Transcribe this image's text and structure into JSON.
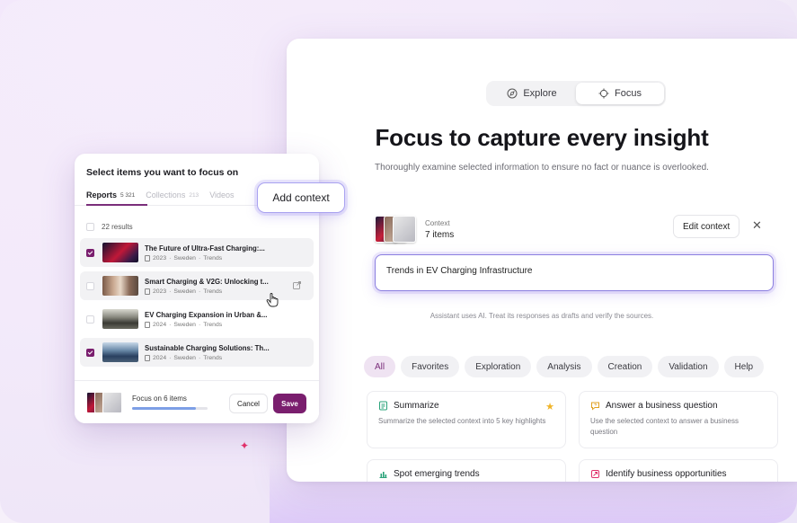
{
  "colors": {
    "accent_plum": "#7a1e6e",
    "focus_border": "#8b7fe0",
    "star": "#f0b428",
    "sparkle": "#e0306a",
    "progress_fill": "#7d9fe6"
  },
  "mode_switch": {
    "explore_label": "Explore",
    "explore_icon": "compass-icon",
    "focus_label": "Focus",
    "focus_icon": "crosshair-icon",
    "active": "Focus"
  },
  "hero": {
    "title": "Focus to capture every insight",
    "subtitle": "Thoroughly examine selected information to ensure no fact or nuance is overlooked."
  },
  "context": {
    "label": "Context",
    "count": "7 items",
    "edit_label": "Edit context",
    "close_icon": "close-icon"
  },
  "query": {
    "value": "Trends in EV Charging Infrastructure"
  },
  "disclaimer": "Assistant uses AI. Treat its responses as drafts and verify the sources.",
  "filters": [
    "All",
    "Favorites",
    "Exploration",
    "Analysis",
    "Creation",
    "Validation",
    "Help"
  ],
  "filters_active": "All",
  "cards": [
    {
      "title": "Summarize",
      "icon": "summarize-icon",
      "desc": "Summarize the selected context into 5 key highlights",
      "favorite": true
    },
    {
      "title": "Answer a business question",
      "icon": "chat-question-icon",
      "desc": "Use the selected context to answer a business question",
      "favorite": false
    },
    {
      "title": "Spot emerging trends",
      "icon": "bar-chart-icon",
      "desc": "",
      "favorite": false
    },
    {
      "title": "Identify business opportunities",
      "icon": "target-icon",
      "desc": "",
      "favorite": false
    }
  ],
  "selector": {
    "title": "Select items you want to focus on",
    "tabs": [
      {
        "label": "Reports",
        "count": "5 321",
        "active": true
      },
      {
        "label": "Collections",
        "count": "213",
        "active": false
      },
      {
        "label": "Videos",
        "count": "",
        "active": false
      }
    ],
    "results": "22 results",
    "items": [
      {
        "title": "The Future of Ultra-Fast Charging:...",
        "year": "2023",
        "country": "Sweden",
        "type": "Trends",
        "checked": true,
        "highlighted": true
      },
      {
        "title": "Smart Charging & V2G: Unlocking t...",
        "year": "2023",
        "country": "Sweden",
        "type": "Trends",
        "checked": false,
        "highlighted": true
      },
      {
        "title": "EV Charging Expansion in Urban &...",
        "year": "2024",
        "country": "Sweden",
        "type": "Trends",
        "checked": false,
        "highlighted": false
      },
      {
        "title": "Sustainable Charging Solutions: Th...",
        "year": "2024",
        "country": "Sweden",
        "type": "Trends",
        "checked": true,
        "highlighted": true
      }
    ],
    "footer": {
      "focus_prefix": "Focus on",
      "focus_count": "6 items",
      "progress": 0.85,
      "cancel_label": "Cancel",
      "save_label": "Save"
    }
  },
  "add_context_label": "Add context"
}
